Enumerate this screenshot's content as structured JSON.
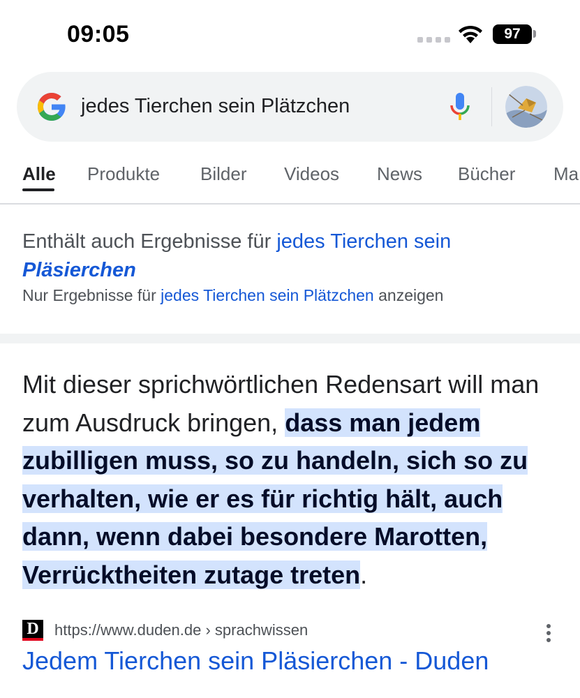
{
  "status_bar": {
    "time": "09:05",
    "battery": "97"
  },
  "search": {
    "query": "jedes Tierchen sein Plätzchen"
  },
  "tabs": [
    "Alle",
    "Produkte",
    "Bilder",
    "Videos",
    "News",
    "Bücher",
    "Ma"
  ],
  "spelling": {
    "prefix": "Enthält auch Ergebnisse für",
    "suggestion_plain": "jedes Tierchen sein",
    "suggestion_bold": "Pläsierchen",
    "only_prefix": "Nur Ergebnisse für",
    "only_link": "jedes Tierchen sein Plätzchen",
    "only_suffix": "anzeigen"
  },
  "snippet": {
    "plain": "Mit dieser sprichwörtlichen Redensart will man zum Ausdruck bringen,",
    "highlighted": "dass man jedem zubilligen muss, so zu handeln, sich so zu verhalten, wie er es für richtig hält, auch dann, wenn dabei besondere Marotten, Verrücktheiten zutage treten",
    "end": "."
  },
  "result": {
    "favicon_letter": "D",
    "url": "https://www.duden.de › sprachwissen",
    "title": "Jedem Tierchen sein Pläsierchen - Duden"
  },
  "colors": {
    "link": "#1558d6",
    "highlight": "#d3e3fd",
    "tab_active": "#202124"
  }
}
